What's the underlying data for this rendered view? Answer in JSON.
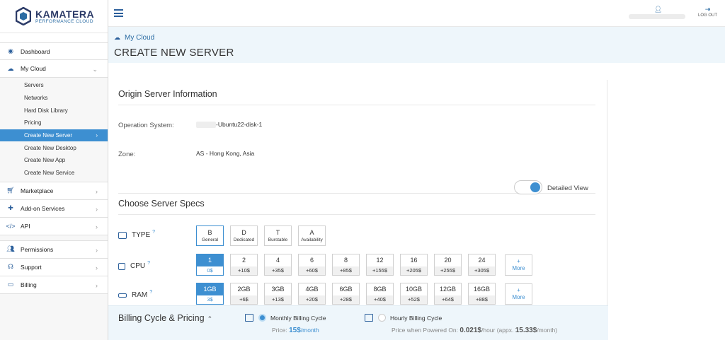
{
  "brand": {
    "name": "KAMATERA",
    "tagline": "PERFORMANCE CLOUD"
  },
  "topbar": {
    "logout_label": "LOG OUT"
  },
  "sidebar": {
    "items_top": [
      {
        "label": "Dashboard",
        "icon": "dashboard-icon"
      },
      {
        "label": "My Cloud",
        "icon": "cloud-icon"
      }
    ],
    "mycloud_sub": [
      {
        "label": "Servers"
      },
      {
        "label": "Networks"
      },
      {
        "label": "Hard Disk Library"
      },
      {
        "label": "Pricing"
      },
      {
        "label": "Create New Server",
        "active": true
      },
      {
        "label": "Create New Desktop"
      },
      {
        "label": "Create New App"
      },
      {
        "label": "Create New Service"
      }
    ],
    "items_mid": [
      {
        "label": "Marketplace",
        "icon": "cart-icon"
      },
      {
        "label": "Add-on Services",
        "icon": "puzzle-icon"
      },
      {
        "label": "API",
        "icon": "code-icon"
      }
    ],
    "items_bottom": [
      {
        "label": "Permissions",
        "icon": "users-icon"
      },
      {
        "label": "Support",
        "icon": "headset-icon"
      },
      {
        "label": "Billing",
        "icon": "credit-card-icon"
      }
    ]
  },
  "breadcrumb": {
    "label": "My Cloud"
  },
  "page_title": "CREATE NEW SERVER",
  "origin": {
    "title": "Origin Server Information",
    "os_label": "Operation System:",
    "os_value": "-Ubuntu22-disk-1",
    "zone_label": "Zone:",
    "zone_value": "AS - Hong Kong, Asia"
  },
  "specs": {
    "title": "Choose Server Specs",
    "detailed_view_label": "Detailed View",
    "type_label": "TYPE",
    "cpu_label": "CPU",
    "ram_label": "RAM",
    "help_mark": "?",
    "types": [
      {
        "code": "B",
        "desc": "General",
        "selected": true
      },
      {
        "code": "D",
        "desc": "Dedicated"
      },
      {
        "code": "T",
        "desc": "Burstable"
      },
      {
        "code": "A",
        "desc": "Availability"
      }
    ],
    "cpu": [
      {
        "value": "1",
        "price": "0$",
        "selected": true
      },
      {
        "value": "2",
        "price": "+10$"
      },
      {
        "value": "4",
        "price": "+35$"
      },
      {
        "value": "6",
        "price": "+60$"
      },
      {
        "value": "8",
        "price": "+85$"
      },
      {
        "value": "12",
        "price": "+155$"
      },
      {
        "value": "16",
        "price": "+205$"
      },
      {
        "value": "20",
        "price": "+255$"
      },
      {
        "value": "24",
        "price": "+305$"
      }
    ],
    "ram": [
      {
        "value": "1GB",
        "price": "3$",
        "selected": true
      },
      {
        "value": "2GB",
        "price": "+6$"
      },
      {
        "value": "3GB",
        "price": "+13$"
      },
      {
        "value": "4GB",
        "price": "+20$"
      },
      {
        "value": "6GB",
        "price": "+28$"
      },
      {
        "value": "8GB",
        "price": "+40$"
      },
      {
        "value": "10GB",
        "price": "+52$"
      },
      {
        "value": "12GB",
        "price": "+64$"
      },
      {
        "value": "16GB",
        "price": "+88$"
      }
    ],
    "more_plus": "+",
    "more_label": "More"
  },
  "billing": {
    "title": "Billing Cycle & Pricing",
    "monthly_label": "Monthly Billing Cycle",
    "hourly_label": "Hourly Billing Cycle",
    "monthly_price_prefix": "Price: ",
    "monthly_price": "15$",
    "monthly_price_suffix": "/month",
    "hourly_price_prefix": "Price when Powered On: ",
    "hourly_price": "0.021$",
    "hourly_price_mid": "/hour (appx. ",
    "hourly_month": "15.33$",
    "hourly_price_suffix": "/month)"
  },
  "colors": {
    "accent": "#3d8fd1",
    "brand": "#2b3a67",
    "header_bg": "#eef6fb"
  }
}
